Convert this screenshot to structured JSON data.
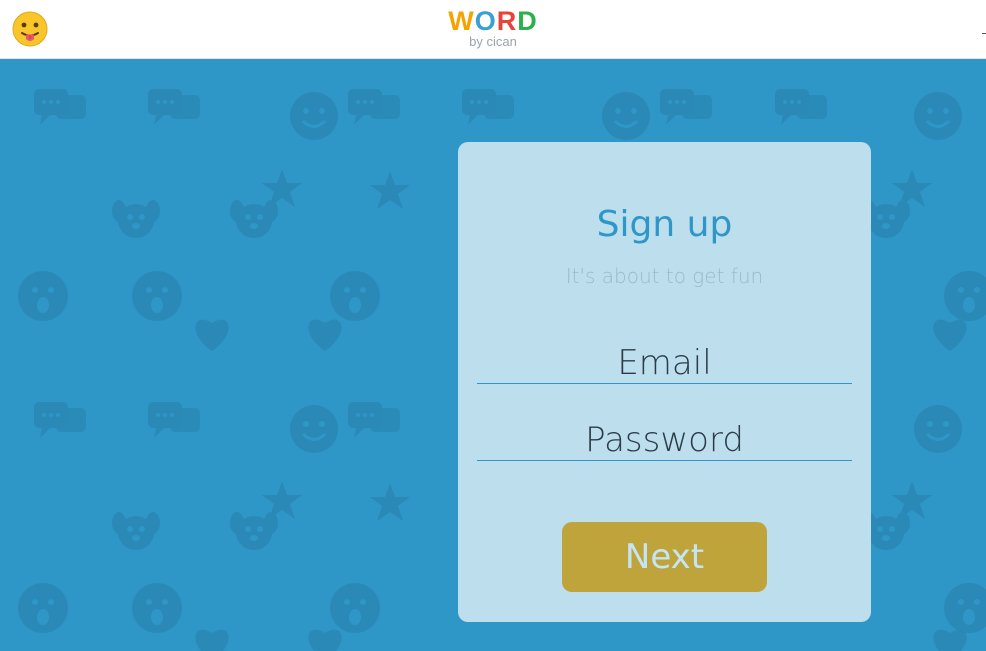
{
  "header": {
    "logo_letters": [
      {
        "char": "W",
        "color": "#f5a300"
      },
      {
        "char": "O",
        "color": "#3aa0d3"
      },
      {
        "char": "R",
        "color": "#e8433a"
      },
      {
        "char": "D",
        "color": "#2bb04a"
      }
    ],
    "logo_sub": "by cican",
    "emoji_icon": "tongue-out-emoji-icon"
  },
  "background": {
    "color": "#2f97c8",
    "pattern_color": "#2a89b7",
    "pattern_icons": [
      "speech-bubbles-icon",
      "smiley-icon",
      "star-icon",
      "puppy-icon",
      "surprised-face-icon",
      "heart-icon"
    ]
  },
  "signup": {
    "title": "Sign up",
    "subtitle": "It's about to get fun",
    "email_placeholder": "Email",
    "password_placeholder": "Password",
    "next_label": "Next"
  },
  "colors": {
    "card": "#bcdeed",
    "accent": "#2f97c8",
    "button": "#bfa43c"
  }
}
